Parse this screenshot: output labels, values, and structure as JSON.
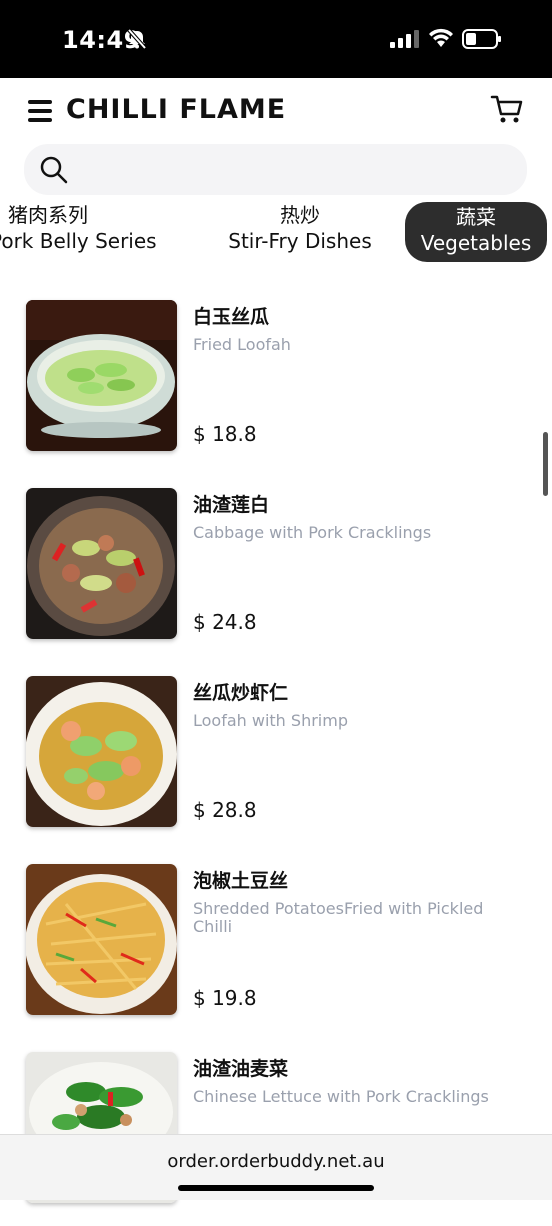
{
  "status_bar": {
    "time": "14:49"
  },
  "header": {
    "brand": "CHILLI FLAME"
  },
  "tabs": [
    {
      "zh": "猪肉系列",
      "en": "Pork Belly Series"
    },
    {
      "zh": "热炒",
      "en": "Stir-Fry Dishes"
    },
    {
      "zh": "蔬菜",
      "en": "Vegetables"
    }
  ],
  "items": [
    {
      "name": "白玉丝瓜",
      "desc": "Fried Loofah",
      "price": "$ 18.8"
    },
    {
      "name": "油渣莲白",
      "desc": "Cabbage with Pork Cracklings",
      "price": "$ 24.8"
    },
    {
      "name": "丝瓜炒虾仁",
      "desc": "Loofah with Shrimp",
      "price": "$ 28.8"
    },
    {
      "name": "泡椒土豆丝",
      "desc": "Shredded PotatoesFried with Pickled Chilli",
      "price": "$ 19.8"
    },
    {
      "name": "油渣油麦菜",
      "desc": "Chinese Lettuce with Pork Cracklings",
      "price": ""
    }
  ],
  "browser": {
    "url": "order.orderbuddy.net.au"
  }
}
